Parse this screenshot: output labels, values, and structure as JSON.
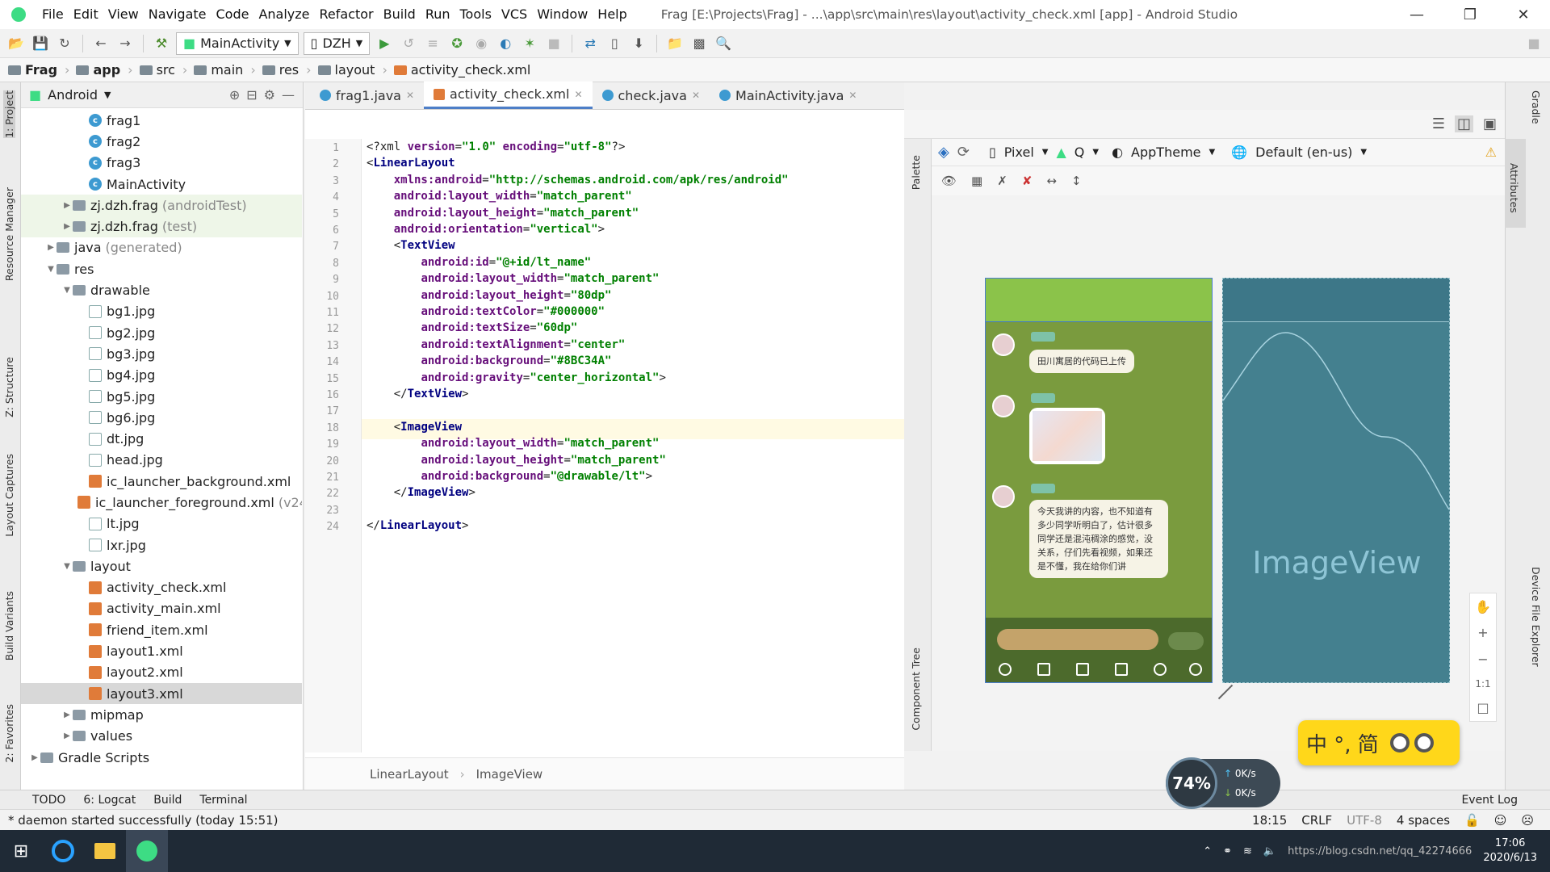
{
  "menu": {
    "items": [
      "File",
      "Edit",
      "View",
      "Navigate",
      "Code",
      "Analyze",
      "Refactor",
      "Build",
      "Run",
      "Tools",
      "VCS",
      "Window",
      "Help"
    ],
    "window_title": "Frag [E:\\Projects\\Frag] - ...\\app\\src\\main\\res\\layout\\activity_check.xml [app] - Android Studio"
  },
  "toolbar": {
    "run_config": "MainActivity",
    "device": "DZH"
  },
  "breadcrumb": [
    "Frag",
    "app",
    "src",
    "main",
    "res",
    "layout",
    "activity_check.xml"
  ],
  "project": {
    "view_label": "Android",
    "tree": [
      {
        "label": "frag1",
        "icon": "class",
        "indent": 4
      },
      {
        "label": "frag2",
        "icon": "class",
        "indent": 4
      },
      {
        "label": "frag3",
        "icon": "class",
        "indent": 4
      },
      {
        "label": "MainActivity",
        "icon": "class",
        "indent": 4
      },
      {
        "label": "zj.dzh.frag",
        "sub": "(androidTest)",
        "icon": "pkg",
        "indent": 3,
        "arrow": "▶",
        "tint": true
      },
      {
        "label": "zj.dzh.frag",
        "sub": "(test)",
        "icon": "pkg",
        "indent": 3,
        "arrow": "▶",
        "tint": true
      },
      {
        "label": "java",
        "sub": "(generated)",
        "icon": "folder",
        "indent": 2,
        "arrow": "▶"
      },
      {
        "label": "res",
        "icon": "folder",
        "indent": 2,
        "arrow": "▼"
      },
      {
        "label": "drawable",
        "icon": "folder",
        "indent": 3,
        "arrow": "▼"
      },
      {
        "label": "bg1.jpg",
        "icon": "img",
        "indent": 4
      },
      {
        "label": "bg2.jpg",
        "icon": "img",
        "indent": 4
      },
      {
        "label": "bg3.jpg",
        "icon": "img",
        "indent": 4
      },
      {
        "label": "bg4.jpg",
        "icon": "img",
        "indent": 4
      },
      {
        "label": "bg5.jpg",
        "icon": "img",
        "indent": 4
      },
      {
        "label": "bg6.jpg",
        "icon": "img",
        "indent": 4
      },
      {
        "label": "dt.jpg",
        "icon": "img",
        "indent": 4
      },
      {
        "label": "head.jpg",
        "icon": "img",
        "indent": 4
      },
      {
        "label": "ic_launcher_background.xml",
        "icon": "xml",
        "indent": 4
      },
      {
        "label": "ic_launcher_foreground.xml",
        "sub": "(v24",
        "icon": "xml",
        "indent": 4
      },
      {
        "label": "lt.jpg",
        "icon": "img",
        "indent": 4
      },
      {
        "label": "lxr.jpg",
        "icon": "img",
        "indent": 4
      },
      {
        "label": "layout",
        "icon": "folder",
        "indent": 3,
        "arrow": "▼"
      },
      {
        "label": "activity_check.xml",
        "icon": "xml",
        "indent": 4
      },
      {
        "label": "activity_main.xml",
        "icon": "xml",
        "indent": 4
      },
      {
        "label": "friend_item.xml",
        "icon": "xml",
        "indent": 4
      },
      {
        "label": "layout1.xml",
        "icon": "xml",
        "indent": 4
      },
      {
        "label": "layout2.xml",
        "icon": "xml",
        "indent": 4
      },
      {
        "label": "layout3.xml",
        "icon": "xml",
        "indent": 4,
        "selected": true
      },
      {
        "label": "mipmap",
        "icon": "folder",
        "indent": 3,
        "arrow": "▶"
      },
      {
        "label": "values",
        "icon": "folder",
        "indent": 3,
        "arrow": "▶"
      },
      {
        "label": "Gradle Scripts",
        "icon": "gradle",
        "indent": 1,
        "arrow": "▶"
      }
    ]
  },
  "side_labels": {
    "left": [
      "1: Project",
      "Resource Manager",
      "Z: Structure",
      "Layout Captures",
      "Build Variants",
      "2: Favorites"
    ],
    "right": [
      "Gradle",
      "Attributes",
      "Device File Explorer"
    ],
    "palette": "Palette",
    "component_tree": "Component Tree"
  },
  "tabs": [
    {
      "label": "frag1.java",
      "kind": "java"
    },
    {
      "label": "activity_check.xml",
      "kind": "xml",
      "active": true
    },
    {
      "label": "check.java",
      "kind": "java"
    },
    {
      "label": "MainActivity.java",
      "kind": "java"
    }
  ],
  "code_lines": [
    "<?xml version=\"1.0\" encoding=\"utf-8\"?>",
    "<LinearLayout",
    "    xmlns:android=\"http://schemas.android.com/apk/res/android\"",
    "    android:layout_width=\"match_parent\"",
    "    android:layout_height=\"match_parent\"",
    "    android:orientation=\"vertical\">",
    "    <TextView",
    "        android:id=\"@+id/lt_name\"",
    "        android:layout_width=\"match_parent\"",
    "        android:layout_height=\"80dp\"",
    "        android:textColor=\"#000000\"",
    "        android:textSize=\"60dp\"",
    "        android:textAlignment=\"center\"",
    "        android:background=\"#8BC34A\"",
    "        android:gravity=\"center_horizontal\">",
    "    </TextView>",
    "",
    "    <ImageView",
    "        android:layout_width=\"match_parent\"",
    "        android:layout_height=\"match_parent\"",
    "        android:background=\"@drawable/lt\">",
    "    </ImageView>",
    "",
    "</LinearLayout>"
  ],
  "editor_crumbs": [
    "LinearLayout",
    "ImageView"
  ],
  "design": {
    "device": "Pixel",
    "api": "Q",
    "theme": "AppTheme",
    "locale": "Default (en-us)",
    "imageview_label": "ImageView",
    "zoom_reset": "1:1",
    "chat_messages": [
      "田川寓居的代码已上传",
      "今天我讲的内容，也不知道有多少同学听明白了，估计很多同学还是混沌稠涂的感觉，没关系，仔们先看视频，如果还是不懂，我在给你们讲"
    ]
  },
  "bottom_tools": [
    "TODO",
    "6: Logcat",
    "Build",
    "Terminal",
    "Event Log"
  ],
  "status": {
    "message": "* daemon started successfully (today 15:51)",
    "position": "18:15",
    "line_sep": "CRLF",
    "encoding": "UTF-8",
    "indent": "4 spaces"
  },
  "overlay": {
    "net_percent": "74%",
    "up_speed": "0K/s",
    "down_speed": "0K/s",
    "ime_text": "中 °, 简"
  },
  "taskbar": {
    "time": "17:06",
    "date": "2020/6/13",
    "url_watermark": "https://blog.csdn.net/qq_42274666"
  }
}
